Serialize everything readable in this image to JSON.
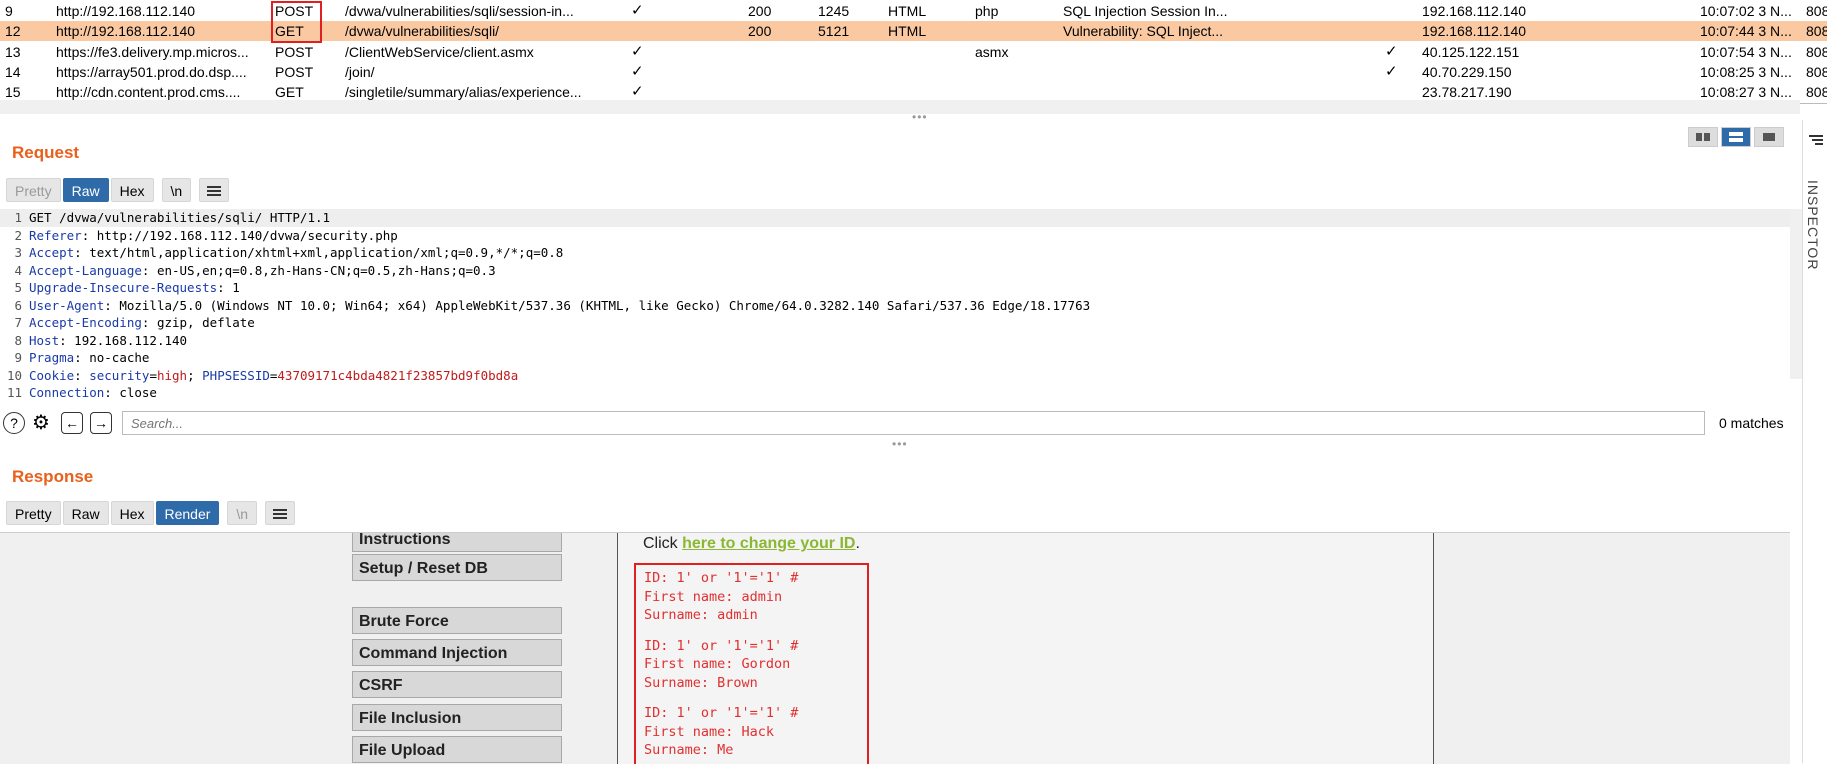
{
  "history": {
    "rows": [
      {
        "num": "9",
        "host": "http://192.168.112.140",
        "method": "POST",
        "url": "/dvwa/vulnerabilities/sqli/session-in...",
        "params": "✓",
        "status": "200",
        "length": "1245",
        "mime": "HTML",
        "ext": "php",
        "title": "SQL Injection Session In...",
        "tls": "",
        "ip": "192.168.112.140",
        "time": "10:07:02 3 N...",
        "port": "808"
      },
      {
        "num": "12",
        "host": "http://192.168.112.140",
        "method": "GET",
        "url": "/dvwa/vulnerabilities/sqli/",
        "params": "",
        "status": "200",
        "length": "5121",
        "mime": "HTML",
        "ext": "",
        "title": "Vulnerability: SQL Inject...",
        "tls": "",
        "ip": "192.168.112.140",
        "time": "10:07:44 3 N...",
        "port": "808"
      },
      {
        "num": "13",
        "host": "https://fe3.delivery.mp.micros...",
        "method": "POST",
        "url": "/ClientWebService/client.asmx",
        "params": "✓",
        "status": "",
        "length": "",
        "mime": "",
        "ext": "asmx",
        "title": "",
        "tls": "✓",
        "ip": "40.125.122.151",
        "time": "10:07:54 3 N...",
        "port": "808"
      },
      {
        "num": "14",
        "host": "https://array501.prod.do.dsp....",
        "method": "POST",
        "url": "/join/",
        "params": "✓",
        "status": "",
        "length": "",
        "mime": "",
        "ext": "",
        "title": "",
        "tls": "✓",
        "ip": "40.70.229.150",
        "time": "10:08:25 3 N...",
        "port": "808"
      },
      {
        "num": "15",
        "host": "http://cdn.content.prod.cms....",
        "method": "GET",
        "url": "/singletile/summary/alias/experience...",
        "params": "✓",
        "status": "",
        "length": "",
        "mime": "",
        "ext": "",
        "title": "",
        "tls": "",
        "ip": "23.78.217.190",
        "time": "10:08:27 3 N...",
        "port": "808"
      }
    ]
  },
  "request": {
    "title": "Request",
    "tabs": [
      "Pretty",
      "Raw",
      "Hex",
      "\\n"
    ],
    "lines": [
      {
        "n": "1",
        "k": "",
        "v": "GET /dvwa/vulnerabilities/sqli/ HTTP/1.1"
      },
      {
        "n": "2",
        "k": "Referer",
        "v": " http://192.168.112.140/dvwa/security.php"
      },
      {
        "n": "3",
        "k": "Accept",
        "v": " text/html,application/xhtml+xml,application/xml;q=0.9,*/*;q=0.8"
      },
      {
        "n": "4",
        "k": "Accept-Language",
        "v": " en-US,en;q=0.8,zh-Hans-CN;q=0.5,zh-Hans;q=0.3"
      },
      {
        "n": "5",
        "k": "Upgrade-Insecure-Requests",
        "v": " 1"
      },
      {
        "n": "6",
        "k": "User-Agent",
        "v": " Mozilla/5.0 (Windows NT 10.0; Win64; x64) AppleWebKit/537.36 (KHTML, like Gecko) Chrome/64.0.3282.140 Safari/537.36 Edge/18.17763"
      },
      {
        "n": "7",
        "k": "Accept-Encoding",
        "v": " gzip, deflate"
      },
      {
        "n": "8",
        "k": "Host",
        "v": " 192.168.112.140"
      },
      {
        "n": "9",
        "k": "Pragma",
        "v": " no-cache"
      },
      {
        "n": "11",
        "k": "Connection",
        "v": " close"
      }
    ],
    "cookie": {
      "n": "10",
      "k": "Cookie",
      "name1": "security",
      "val1": "high",
      "name2": "PHPSESSID",
      "val2": "43709171c4bda4821f23857bd9f0bd8a"
    },
    "search_placeholder": "Search...",
    "matches": "0 matches"
  },
  "response": {
    "title": "Response",
    "tabs": [
      "Pretty",
      "Raw",
      "Hex",
      "Render",
      "\\n"
    ],
    "menu": [
      "Instructions",
      "Setup / Reset DB",
      "Brute Force",
      "Command Injection",
      "CSRF",
      "File Inclusion",
      "File Upload"
    ],
    "click_prefix": "Click ",
    "click_link": "here to change your ID",
    "click_suffix": ".",
    "results": [
      [
        "ID: 1' or '1'='1' #",
        "First name: admin",
        "Surname: admin"
      ],
      [
        "ID: 1' or '1'='1' #",
        "First name: Gordon",
        "Surname: Brown"
      ],
      [
        "ID: 1' or '1'='1' #",
        "First name: Hack",
        "Surname: Me"
      ]
    ]
  },
  "inspector": {
    "label": "INSPECTOR"
  },
  "colors": {
    "accent": "#e8601c",
    "selected_row": "#fbc9a1",
    "active_tab": "#2f6ba8",
    "highlight_border": "#e02020",
    "result_text": "#e03030",
    "link": "#8ab833"
  }
}
